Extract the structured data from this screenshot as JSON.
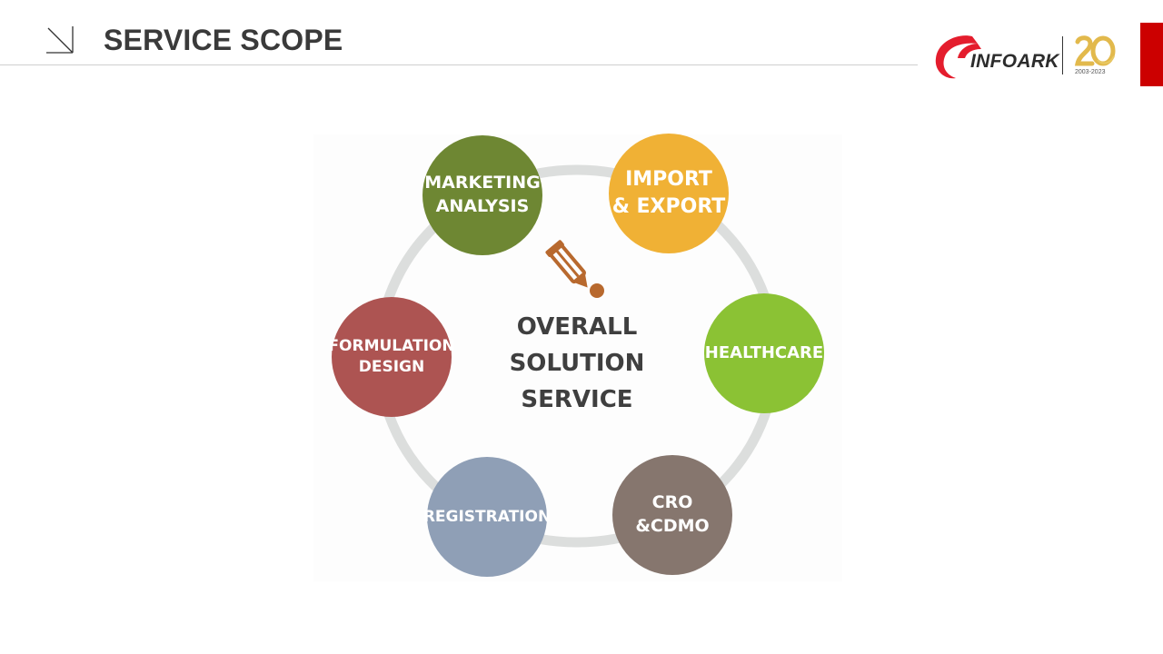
{
  "header": {
    "title": "SERVICE SCOPE"
  },
  "logo": {
    "brand_text": "INFOARK",
    "anniversary_years": "2003-2023"
  },
  "diagram": {
    "center_label": "OVERALL\nSOLUTION\nSERVICE",
    "nodes": [
      {
        "label": "MARKETING\nANALYSIS",
        "color": "#6e8733"
      },
      {
        "label": "IMPORT\n& EXPORT",
        "color": "#f0b135"
      },
      {
        "label": "HEALTHCARE",
        "color": "#8bc234"
      },
      {
        "label": "CRO\n&CDMO",
        "color": "#86766e"
      },
      {
        "label": "REGISTRATION",
        "color": "#8f9fb6"
      },
      {
        "label": "FORMULATION\nDESIGN",
        "color": "#ad5452"
      }
    ]
  },
  "colors": {
    "accent_red": "#cc0000",
    "title_text": "#3a3a3a",
    "ring": "#dcdedd",
    "pencil": "#b8692e"
  }
}
